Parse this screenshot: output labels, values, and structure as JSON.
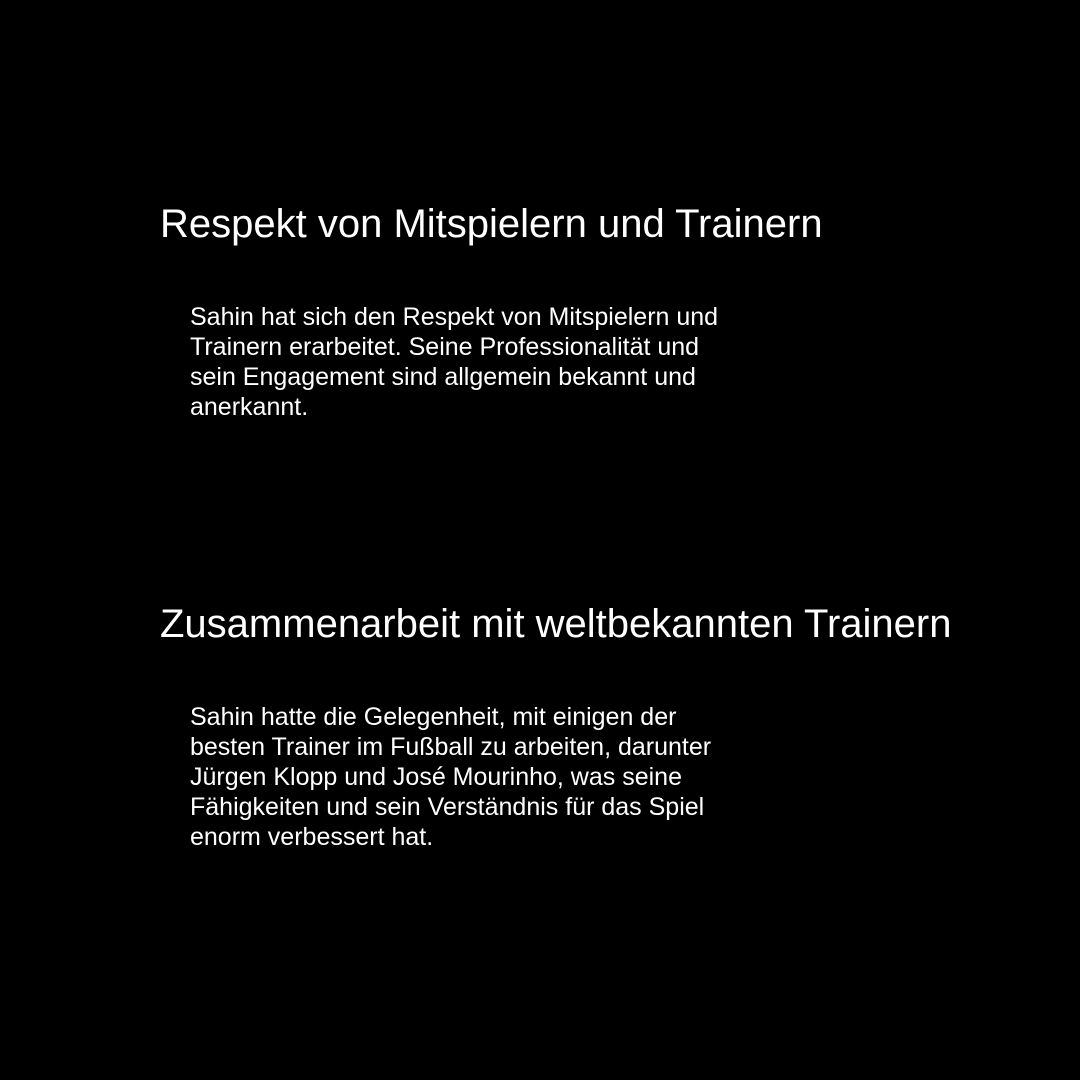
{
  "sections": [
    {
      "heading": "Respekt von Mitspielern und Trainern",
      "lines": [
        "Sahin hat sich den Respekt von Mitspielern und",
        "Trainern erarbeitet. Seine Professionalität und",
        "sein Engagement sind allgemein bekannt und",
        "anerkannt."
      ]
    },
    {
      "heading": "Zusammenarbeit mit weltbekannten Trainern",
      "lines": [
        "Sahin hatte die Gelegenheit, mit einigen der",
        "besten Trainer im Fußball zu arbeiten, darunter",
        "Jürgen Klopp und José Mourinho, was seine",
        "Fähigkeiten und sein Verständnis für das Spiel",
        "enorm verbessert hat."
      ]
    }
  ],
  "colors": {
    "background": "#000000",
    "text": "#ffffff"
  }
}
